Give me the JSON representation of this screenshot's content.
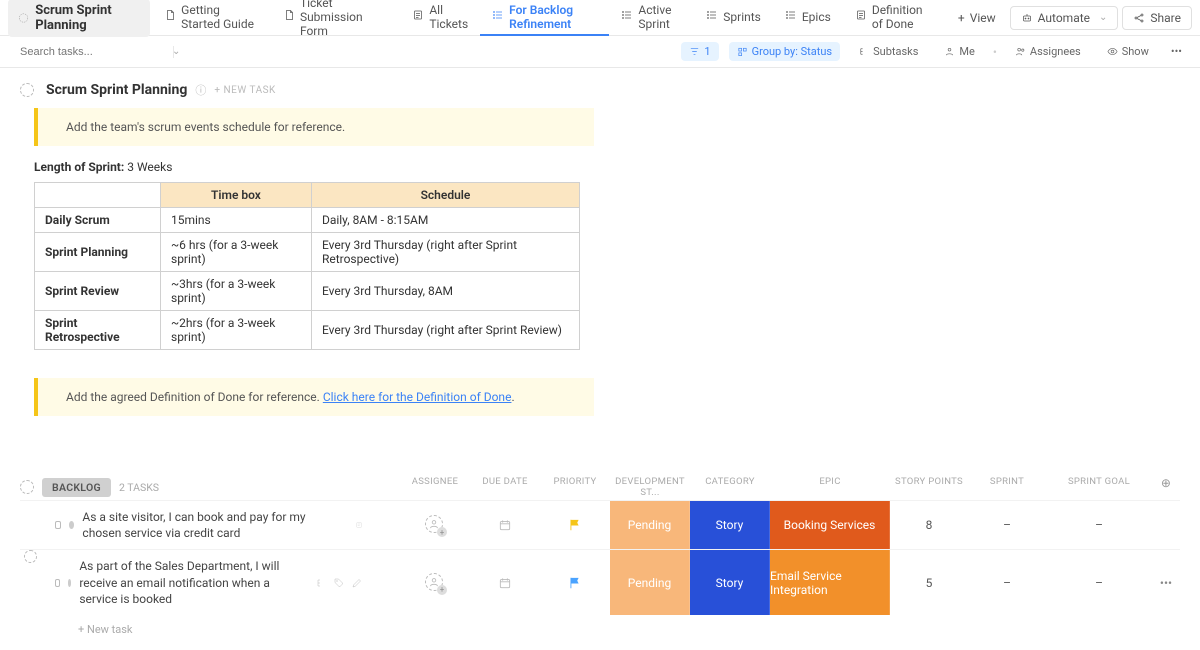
{
  "header": {
    "project_title": "Scrum Sprint Planning",
    "tabs": [
      {
        "label": "Getting Started Guide"
      },
      {
        "label": "Ticket Submission Form"
      },
      {
        "label": "All Tickets"
      },
      {
        "label": "For Backlog Refinement",
        "active": true
      },
      {
        "label": "Active Sprint"
      },
      {
        "label": "Sprints"
      },
      {
        "label": "Epics"
      },
      {
        "label": "Definition of Done"
      }
    ],
    "add_view": "View",
    "automate": "Automate",
    "share": "Share"
  },
  "subnav": {
    "search_placeholder": "Search tasks...",
    "filter_count": "1",
    "group_by": "Group by: Status",
    "subtasks": "Subtasks",
    "me": "Me",
    "assignees": "Assignees",
    "show": "Show"
  },
  "doc": {
    "title": "Scrum Sprint Planning",
    "new_task": "+ NEW TASK",
    "callout1": "Add the team's scrum events schedule for reference.",
    "length_label": "Length of Sprint:",
    "length_value": " 3 Weeks",
    "table": {
      "head_timebox": "Time box",
      "head_schedule": "Schedule",
      "rows": [
        {
          "name": "Daily Scrum",
          "tb": "15mins",
          "sch": "Daily, 8AM - 8:15AM"
        },
        {
          "name": "Sprint Planning",
          "tb": "~6 hrs (for a 3-week sprint)",
          "sch": "Every 3rd Thursday (right after Sprint Retrospective)"
        },
        {
          "name": "Sprint Review",
          "tb": "~3hrs (for a 3-week sprint)",
          "sch": "Every 3rd Thursday, 8AM"
        },
        {
          "name": "Sprint Retrospective",
          "tb": "~2hrs (for a 3-week sprint)",
          "sch": "Every 3rd Thursday (right after Sprint Review)"
        }
      ]
    },
    "callout2_pre": "Add the agreed Definition of Done for reference. ",
    "callout2_link": "Click here for the Definition of Done",
    "callout2_post": "."
  },
  "backlog": {
    "status_label": "BACKLOG",
    "task_count": "2 TASKS",
    "columns": {
      "assignee": "ASSIGNEE",
      "due": "DUE DATE",
      "priority": "PRIORITY",
      "dev": "DEVELOPMENT ST...",
      "category": "CATEGORY",
      "epic": "EPIC",
      "sp": "STORY POINTS",
      "sprint": "SPRINT",
      "goal": "SPRINT GOAL"
    },
    "rows": [
      {
        "text": "As a site visitor, I can book and pay for my chosen service via credit card",
        "dev": "Pending",
        "category": "Story",
        "epic": "Booking Services",
        "epic_class": "a",
        "sp": "8",
        "sprint": "–",
        "goal": "–",
        "flag": "y",
        "show_more": false
      },
      {
        "text": "As part of the Sales Department, I will receive an email notification when a service is booked",
        "dev": "Pending",
        "category": "Story",
        "epic": "Email Service Integration",
        "epic_class": "b",
        "sp": "5",
        "sprint": "–",
        "goal": "–",
        "flag": "b",
        "show_more": true
      }
    ],
    "new_task": "+ New task"
  }
}
